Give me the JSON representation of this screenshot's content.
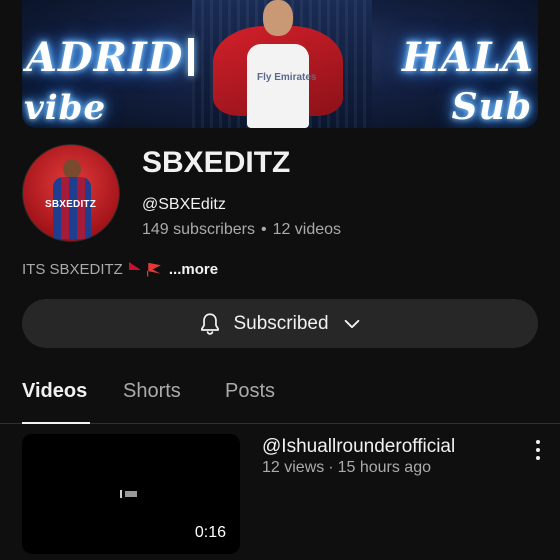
{
  "banner": {
    "text_left_top": "ADRID",
    "text_left_bottom": "vibe",
    "text_right_top": "HALA",
    "text_right_bottom": "Sub",
    "jersey_text": "Fly Emirates"
  },
  "channel": {
    "avatar_text": "SBXEDITZ",
    "name": "SBXEDITZ",
    "handle": "@SBXEditz",
    "subscribers": "149 subscribers",
    "videos": "12 videos",
    "separator": "•",
    "description": "ITS SBXEDITZ",
    "more_label": "...more"
  },
  "subscribe_button": {
    "label": "Subscribed",
    "icon": "bell-icon"
  },
  "tabs": [
    {
      "label": "Videos",
      "active": true
    },
    {
      "label": "Shorts",
      "active": false
    },
    {
      "label": "Posts",
      "active": false
    }
  ],
  "videos": [
    {
      "title": "@Ishuallrounderofficial",
      "views": "12 views",
      "separator": "·",
      "age": "15 hours ago",
      "duration": "0:16"
    }
  ],
  "colors": {
    "background": "#0f0f0f",
    "button_bg": "#272727",
    "text_primary": "#f1f1f1",
    "text_secondary": "#aaaaaa"
  }
}
